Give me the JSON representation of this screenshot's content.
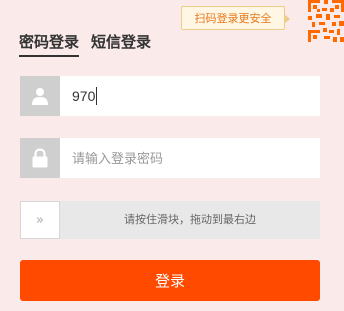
{
  "tabs": {
    "password_login": "密码登录",
    "sms_login": "短信登录"
  },
  "qr": {
    "tip": "扫码登录更安全"
  },
  "form": {
    "username_value": "970",
    "password_placeholder": "请输入登录密码"
  },
  "slider": {
    "handle_glyph": "»",
    "text": "请按住滑块，拖动到最右边"
  },
  "login_button": "登录",
  "colors": {
    "background": "#fbeaea",
    "accent": "#ff4a00",
    "qr_orange": "#ff6a00",
    "icon_box": "#cfcfcf"
  },
  "icons": {
    "user": "user-icon",
    "lock": "lock-icon",
    "qr": "qr-code-icon",
    "slider": "double-chevron-right-icon"
  }
}
